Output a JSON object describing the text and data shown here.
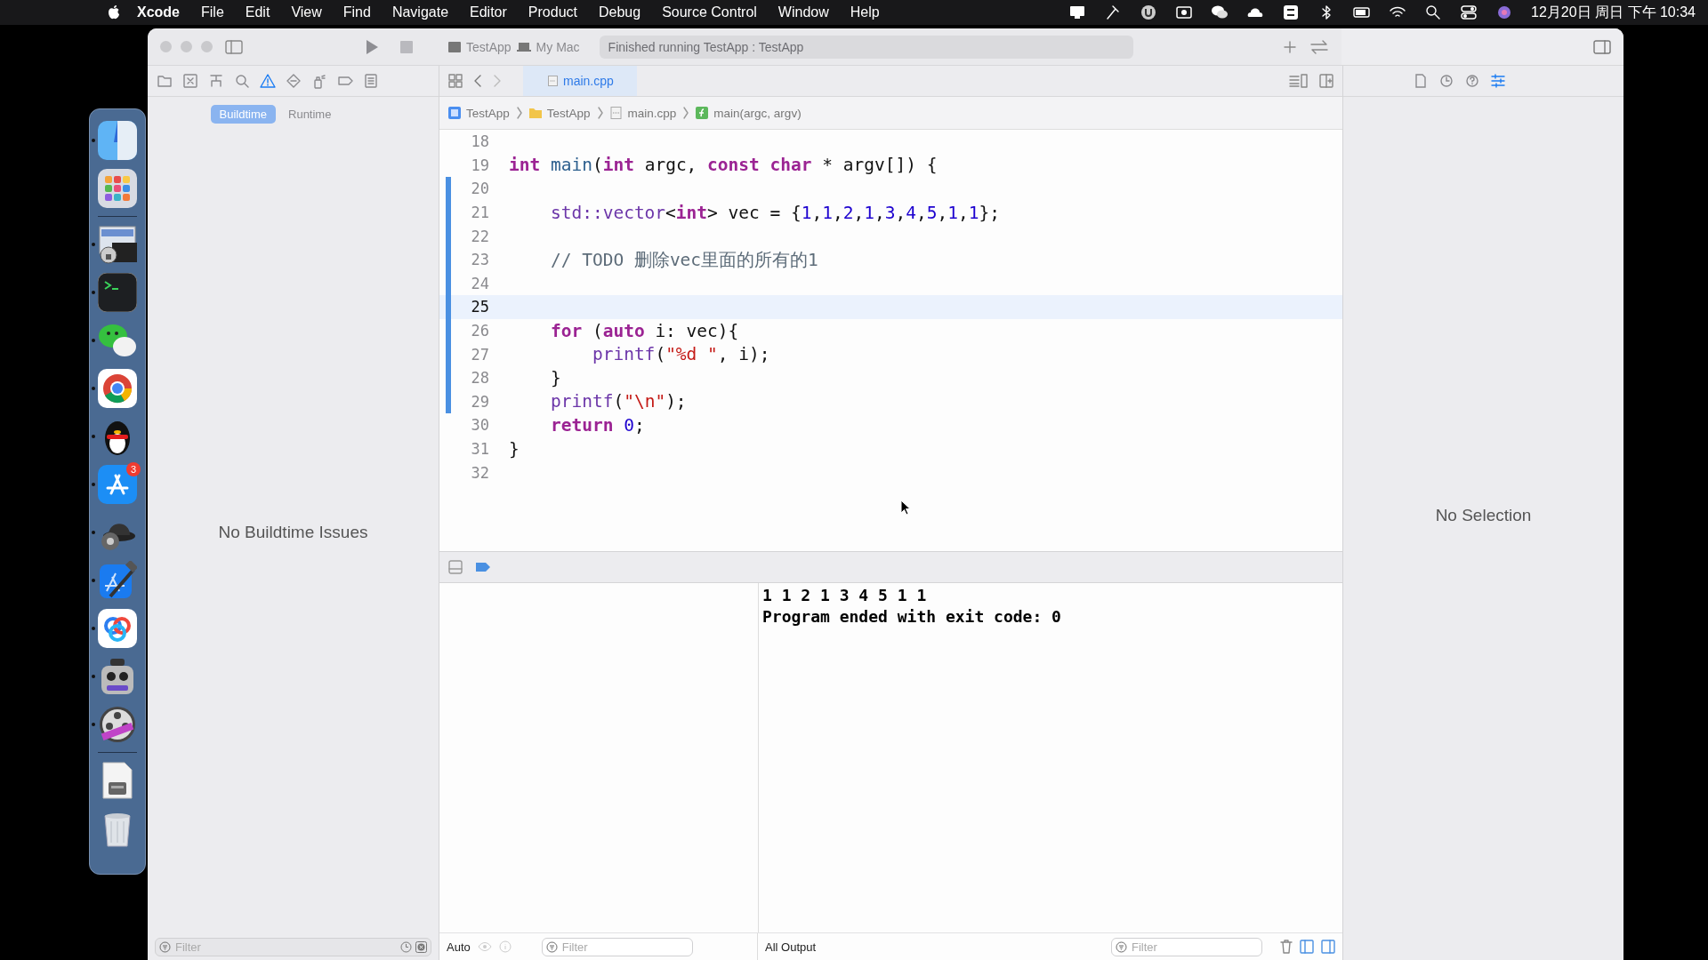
{
  "menu_bar": {
    "items": [
      {
        "label": "Xcode",
        "app": true
      },
      {
        "label": "File",
        "app": false
      },
      {
        "label": "Edit",
        "app": false
      },
      {
        "label": "View",
        "app": false
      },
      {
        "label": "Find",
        "app": false
      },
      {
        "label": "Navigate",
        "app": false
      },
      {
        "label": "Editor",
        "app": false
      },
      {
        "label": "Product",
        "app": false
      },
      {
        "label": "Debug",
        "app": false
      },
      {
        "label": "Source Control",
        "app": false
      },
      {
        "label": "Window",
        "app": false
      },
      {
        "label": "Help",
        "app": false
      }
    ],
    "clock": "12月20日 周日 下午 10:34"
  },
  "dock": {
    "items": [
      {
        "kind": "finder",
        "running": true
      },
      {
        "kind": "launchpad",
        "running": false
      },
      {
        "kind": "separator"
      },
      {
        "kind": "keychain",
        "running": true
      },
      {
        "kind": "terminal",
        "running": true
      },
      {
        "kind": "chat",
        "running": true
      },
      {
        "kind": "browser",
        "running": true
      },
      {
        "kind": "penguin",
        "running": true
      },
      {
        "kind": "store",
        "running": true,
        "badge": "3"
      },
      {
        "kind": "hat",
        "running": true
      },
      {
        "kind": "xcode",
        "running": true
      },
      {
        "kind": "cloud",
        "running": true
      },
      {
        "kind": "robot",
        "running": true
      },
      {
        "kind": "film",
        "running": true
      },
      {
        "kind": "separator"
      },
      {
        "kind": "downloads",
        "running": false
      },
      {
        "kind": "trash",
        "running": false
      }
    ]
  },
  "window": {
    "scheme": "TestApp",
    "destination": "My Mac",
    "status": "Finished running TestApp : TestApp"
  },
  "navigator": {
    "tabs": [
      {
        "kind": "folder",
        "selected": false
      },
      {
        "kind": "xbox",
        "selected": false
      },
      {
        "kind": "hierarchy",
        "selected": false
      },
      {
        "kind": "search",
        "selected": false
      },
      {
        "kind": "warning",
        "selected": true
      },
      {
        "kind": "diamond",
        "selected": false
      },
      {
        "kind": "spray",
        "selected": false
      },
      {
        "kind": "tag",
        "selected": false
      },
      {
        "kind": "list",
        "selected": false
      }
    ],
    "scopes": [
      {
        "label": "Buildtime",
        "selected": true
      },
      {
        "label": "Runtime",
        "selected": false
      }
    ],
    "message": "No Buildtime Issues",
    "filter": {
      "placeholder": "Filter"
    }
  },
  "editor": {
    "tabs": [
      {
        "label": "main.cpp",
        "selected": true
      }
    ],
    "breadcrumb": [
      {
        "label": "TestApp",
        "kind": "project"
      },
      {
        "label": "TestApp",
        "kind": "folder"
      },
      {
        "label": "main.cpp",
        "kind": "file"
      },
      {
        "label": "main(argc, argv)",
        "kind": "function"
      }
    ],
    "lines": [
      {
        "number": "18",
        "current": false,
        "changed": false
      },
      {
        "number": "19",
        "current": false,
        "changed": false,
        "tokens": [
          {
            "kind": "keyword",
            "text": "int"
          },
          {
            "kind": "function",
            "text": " main"
          },
          {
            "kind": "plain",
            "text": "("
          },
          {
            "kind": "keyword",
            "text": "int"
          },
          {
            "kind": "plain",
            "text": " argc, "
          },
          {
            "kind": "keyword",
            "text": "const"
          },
          {
            "kind": "keyword",
            "text": " char"
          },
          {
            "kind": "plain",
            "text": " * argv[]) {"
          }
        ]
      },
      {
        "number": "20",
        "current": false,
        "changed": true
      },
      {
        "number": "21",
        "current": false,
        "changed": true,
        "tokens": [
          {
            "kind": "type",
            "text": "    std::vector"
          },
          {
            "kind": "plain",
            "text": "<"
          },
          {
            "kind": "keyword",
            "text": "int"
          },
          {
            "kind": "plain",
            "text": "> vec = {"
          },
          {
            "kind": "number",
            "text": "1"
          },
          {
            "kind": "plain",
            "text": ","
          },
          {
            "kind": "number",
            "text": "1"
          },
          {
            "kind": "plain",
            "text": ","
          },
          {
            "kind": "number",
            "text": "2"
          },
          {
            "kind": "plain",
            "text": ","
          },
          {
            "kind": "number",
            "text": "1"
          },
          {
            "kind": "plain",
            "text": ","
          },
          {
            "kind": "number",
            "text": "3"
          },
          {
            "kind": "plain",
            "text": ","
          },
          {
            "kind": "number",
            "text": "4"
          },
          {
            "kind": "plain",
            "text": ","
          },
          {
            "kind": "number",
            "text": "5"
          },
          {
            "kind": "plain",
            "text": ","
          },
          {
            "kind": "number",
            "text": "1"
          },
          {
            "kind": "plain",
            "text": ","
          },
          {
            "kind": "number",
            "text": "1"
          },
          {
            "kind": "plain",
            "text": "};"
          }
        ]
      },
      {
        "number": "22",
        "current": false,
        "changed": true
      },
      {
        "number": "23",
        "current": false,
        "changed": true,
        "tokens": [
          {
            "kind": "comment",
            "text": "    // TODO 删除vec里面的所有的1"
          }
        ]
      },
      {
        "number": "24",
        "current": false,
        "changed": true
      },
      {
        "number": "25",
        "current": true,
        "changed": true
      },
      {
        "number": "26",
        "current": false,
        "changed": true,
        "tokens": [
          {
            "kind": "keyword",
            "text": "    for"
          },
          {
            "kind": "plain",
            "text": " ("
          },
          {
            "kind": "keyword",
            "text": "auto"
          },
          {
            "kind": "plain",
            "text": " i: vec){"
          }
        ]
      },
      {
        "number": "27",
        "current": false,
        "changed": true,
        "tokens": [
          {
            "kind": "type",
            "text": "        printf"
          },
          {
            "kind": "plain",
            "text": "("
          },
          {
            "kind": "string",
            "text": "\"%d \""
          },
          {
            "kind": "plain",
            "text": ", i);"
          }
        ]
      },
      {
        "number": "28",
        "current": false,
        "changed": true,
        "tokens": [
          {
            "kind": "plain",
            "text": "    }"
          }
        ]
      },
      {
        "number": "29",
        "current": false,
        "changed": true,
        "tokens": [
          {
            "kind": "type",
            "text": "    printf"
          },
          {
            "kind": "plain",
            "text": "("
          },
          {
            "kind": "string",
            "text": "\"\\n\""
          },
          {
            "kind": "plain",
            "text": ");"
          }
        ]
      },
      {
        "number": "30",
        "current": false,
        "changed": false,
        "tokens": [
          {
            "kind": "keyword",
            "text": "    return"
          },
          {
            "kind": "number",
            "text": " 0"
          },
          {
            "kind": "plain",
            "text": ";"
          }
        ]
      },
      {
        "number": "31",
        "current": false,
        "changed": false,
        "tokens": [
          {
            "kind": "plain",
            "text": "}"
          }
        ]
      },
      {
        "number": "32",
        "current": false,
        "changed": false
      }
    ]
  },
  "debug": {
    "variables_mode": "Auto",
    "variables_filter": {
      "placeholder": "Filter"
    },
    "output_mode": "All Output",
    "output_filter": {
      "placeholder": "Filter"
    },
    "console": [
      "1 1 2 1 3 4 5 1 1",
      "Program ended with exit code: 0"
    ]
  },
  "inspector": {
    "tabs": [
      {
        "kind": "file",
        "selected": false
      },
      {
        "kind": "clock",
        "selected": false
      },
      {
        "kind": "help",
        "selected": false
      },
      {
        "kind": "sliders",
        "selected": true
      }
    ],
    "message": "No Selection"
  }
}
